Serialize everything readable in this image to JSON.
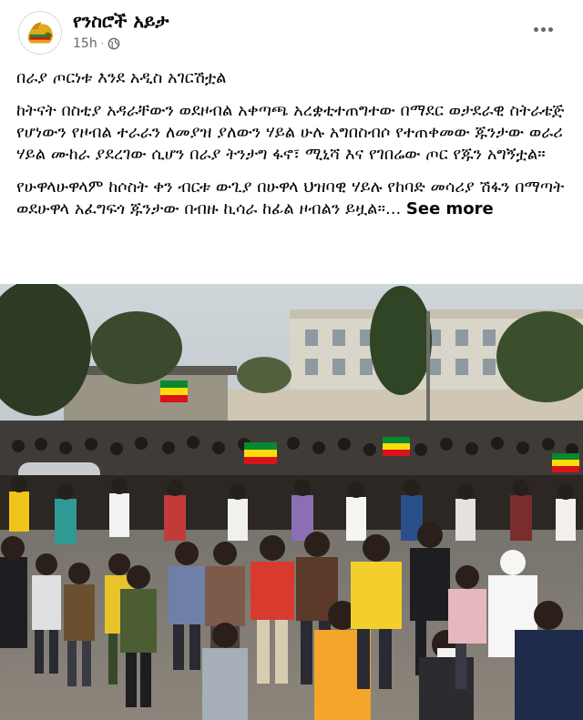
{
  "post": {
    "page_name": "የንስሮች አይታ",
    "timestamp": "15h",
    "separator": "·",
    "audience_icon": "globe-icon",
    "more_icon": "more-options-icon",
    "paragraphs": [
      "በራያ ጦርነቱ እንደ አዲስ አገርሽቷል",
      "ከትናት በስቲያ አዳራቸውን ወደዞብል አቀጣጫ አረቋቲተጠግተው በማደር ወታደራዊ ስትራቴጅ የሆነውን የዞብል ተራራን ለመያዝ ያለውን ሃይል ሁሉ አግበስብሶ የተጠቀመው ጁንታው ወራሪ ሃይል ሙከራ ያደረገው ሲሆን በራያ ትንታግ ፋኖ፣ ሚኒሻ እና የገበሬው ጦር የጁን አግኝቷል።",
      "የሁዋላሁዋላም ከሶስት ቀን ብርቱ ውጊያ በሁዋላ ህዝባዊ ሃይሉ የከባድ መሳሪያ ሽፋን በማጣት ወደሁዋላ አፈግፍጎ ጁንታው በብዙ ኪሳራ ከፊል ዞብልን ይዟል።..."
    ],
    "see_more_label": "See more",
    "photo_icon": "crowd-photo"
  },
  "colors": {
    "text": "#050505",
    "secondary": "#65676b",
    "flag_green": "#078930",
    "flag_yellow": "#fcdd09",
    "flag_red": "#da121a"
  }
}
